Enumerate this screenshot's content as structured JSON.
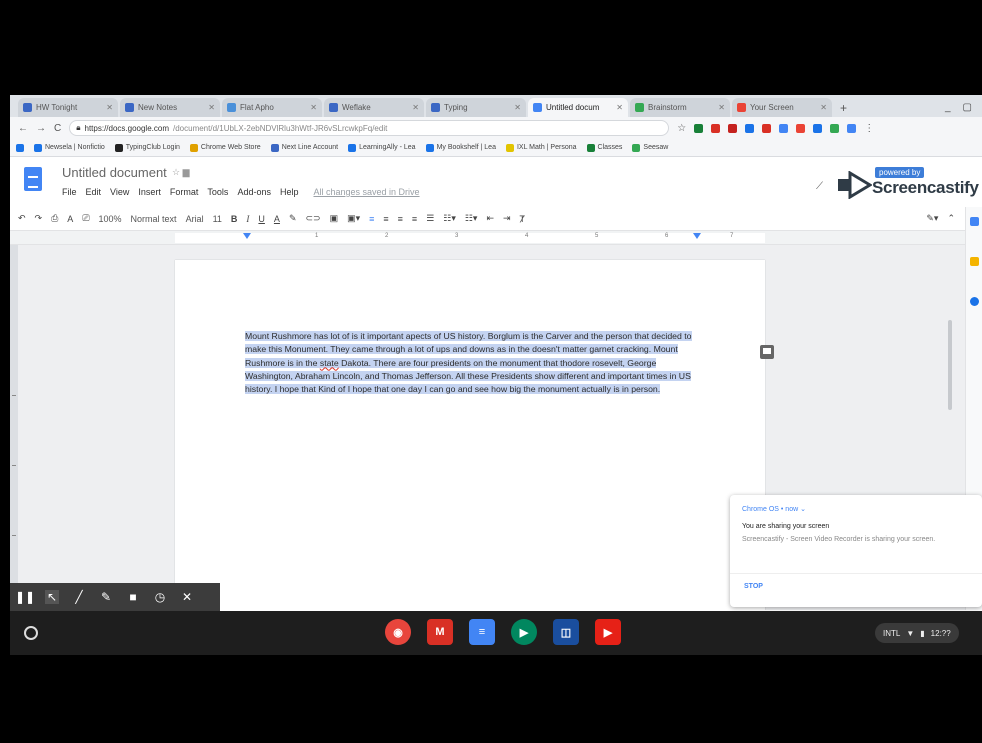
{
  "browser": {
    "tabs": [
      {
        "label": "HW Tonight",
        "color": "#3b67c4",
        "active": false
      },
      {
        "label": "New Notes",
        "color": "#3b67c4",
        "active": false
      },
      {
        "label": "Flat Apho",
        "color": "#4a90d9",
        "active": false
      },
      {
        "label": "Weflake",
        "color": "#3b67c4",
        "active": false
      },
      {
        "label": "Typing",
        "color": "#3b67c4",
        "active": false
      },
      {
        "label": "Untitled docum",
        "color": "#4285f4",
        "active": true
      },
      {
        "label": "Brainstorm",
        "color": "#34a853",
        "active": false
      },
      {
        "label": "Your Screen",
        "color": "#ea4335",
        "active": false
      }
    ],
    "new_tab": "+",
    "window_controls": [
      "_",
      "▢"
    ],
    "url_host": "https://docs.google.com",
    "url_path": "/document/d/1UbLX-2ebNDVlRlu3hWtf-JR6vSLrcwkpFq/edit"
  },
  "bookmarks": [
    {
      "label": "Newsela | Nonfictio",
      "color": "#1a73e8"
    },
    {
      "label": "TypingClub Login",
      "color": "#222222"
    },
    {
      "label": "Chrome Web Store",
      "color": "#e0a100"
    },
    {
      "label": "Next Line Account",
      "color": "#3b67c4"
    },
    {
      "label": "LearningAlly - Lea",
      "color": "#1a73e8"
    },
    {
      "label": "My Bookshelf | Lea",
      "color": "#1a73e8"
    },
    {
      "label": "IXL Math | Persona",
      "color": "#e2c400"
    },
    {
      "label": "Classes",
      "color": "#188038"
    },
    {
      "label": "Seesaw",
      "color": "#34a853"
    }
  ],
  "docs": {
    "title": "Untitled document",
    "title_icons": "☆ ▆",
    "menu": [
      "File",
      "Edit",
      "View",
      "Insert",
      "Format",
      "Tools",
      "Add-ons",
      "Help"
    ],
    "saved_status": "All changes saved in Drive",
    "toolbar": {
      "undo": "↶",
      "redo": "↷",
      "print": "⎙",
      "spell": "A",
      "paint": "⎚",
      "zoom": "100%",
      "style": "Normal text",
      "font": "Arial",
      "size": "11",
      "bold": "B",
      "italic": "I",
      "underline": "U",
      "text_color": "A",
      "highlight": "✎",
      "link": "⊂⊃",
      "comment": "▣",
      "image": "▣▾",
      "align": [
        "≡",
        "≡",
        "≡",
        "≡"
      ],
      "spacing": "☰",
      "lists": [
        "☷▾",
        "☷▾"
      ],
      "indent": [
        "⇤",
        "⇥"
      ],
      "clear": "Ⱦ",
      "edit_mode": "✎▾",
      "collapse": "⌃"
    },
    "ruler_numbers": [
      "1",
      "2",
      "3",
      "4",
      "5",
      "6",
      "7"
    ],
    "body": {
      "text_before_typo": "Mount Rushmore has lot of is it important apects of US history. Borglum is the Carver and the person that decided to make this Monument. They came through a lot of ups and downs as in the doesn't matter garnet cracking. Mount Rushmore is in the ",
      "typo": "state",
      "text_after_typo": " Dakota. There are four presidents on the monument that thodore rosevelt, George Washington, Abraham Lincoln, and Thomas Jefferson. All these Presidents show different and important times in US history. I hope that Kind of I hope that one day I can go and see how big the monument actually is in person."
    }
  },
  "screencastify": {
    "powered_by": "powered by",
    "brand": "Screencastify",
    "tools": [
      "❚❚",
      "↖",
      "╱",
      "✎",
      "■",
      "◷",
      "✕"
    ]
  },
  "notification": {
    "source": "Chrome OS • now ⌄",
    "title": "You are sharing your screen",
    "body": "Screencastify - Screen Video Recorder is sharing your screen.",
    "stop_label": "STOP"
  },
  "shelf": {
    "apps": [
      {
        "name": "chrome",
        "color": "#e8453c",
        "glyph": "◉"
      },
      {
        "name": "gmail",
        "color": "#d93025",
        "glyph": "M"
      },
      {
        "name": "docs",
        "color": "#4285f4",
        "glyph": "≡"
      },
      {
        "name": "play-store",
        "color": "#01875f",
        "glyph": "▶"
      },
      {
        "name": "app-blue",
        "color": "#1a4e9e",
        "glyph": "◫"
      },
      {
        "name": "youtube",
        "color": "#e62117",
        "glyph": "▶"
      }
    ],
    "status": {
      "network": "INTL",
      "time": "12:??"
    }
  },
  "colors": {
    "accent": "#4285f4",
    "selection": "#c4d3f1"
  }
}
